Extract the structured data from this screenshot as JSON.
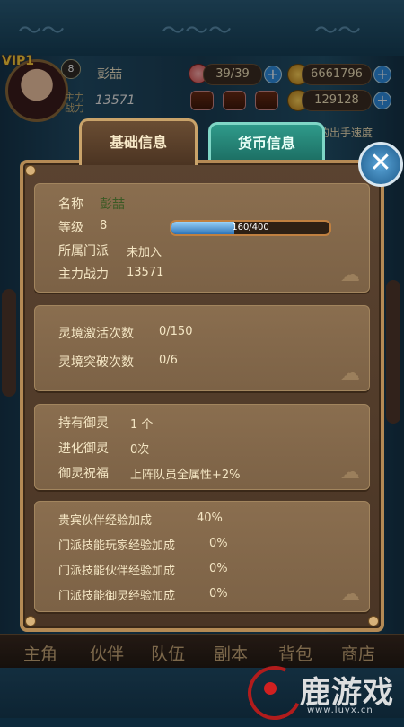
{
  "hud": {
    "vip_label": "VIP1",
    "level": "8",
    "player_name": "彭喆",
    "power_label_1": "主力",
    "power_label_2": "战力",
    "power_value": "13571",
    "stamina": "39/39",
    "gold": "6661796",
    "gems": "129128",
    "hint_text": "的出手速度"
  },
  "tabs": {
    "basic": "基础信息",
    "currency": "货币信息"
  },
  "basic": {
    "name_label": "名称",
    "name_value": "彭喆",
    "level_label": "等级",
    "level_value": "8",
    "exp_text": "160/400",
    "exp_ratio": 0.4,
    "sect_label": "所属门派",
    "sect_value": "未加入",
    "power_label": "主力战力",
    "power_value": "13571"
  },
  "realm": {
    "activate_label": "灵境激活次数",
    "activate_value": "0/150",
    "breakthrough_label": "灵境突破次数",
    "breakthrough_value": "0/6"
  },
  "spirit": {
    "owned_label": "持有御灵",
    "owned_value": "1 个",
    "evolve_label": "进化御灵",
    "evolve_value": "0次",
    "bless_label": "御灵祝福",
    "bless_value": "上阵队员全属性+2%"
  },
  "bonus": {
    "vip_label": "贵宾伙伴经验加成",
    "vip_value": "40%",
    "player_label": "门派技能玩家经验加成",
    "player_value": "0%",
    "partner_label": "门派技能伙伴经验加成",
    "partner_value": "0%",
    "spirit_label": "门派技能御灵经验加成",
    "spirit_value": "0%"
  },
  "nav": [
    "主角",
    "伙伴",
    "队伍",
    "副本",
    "背包",
    "商店"
  ],
  "watermark": {
    "text": "鹿游戏",
    "url": "www.luyx.cn"
  },
  "colors": {
    "frame": "#b48a55",
    "panel": "#8a6e4f",
    "accent_tab": "#2f9a8a",
    "close": "#1d5a8a"
  }
}
